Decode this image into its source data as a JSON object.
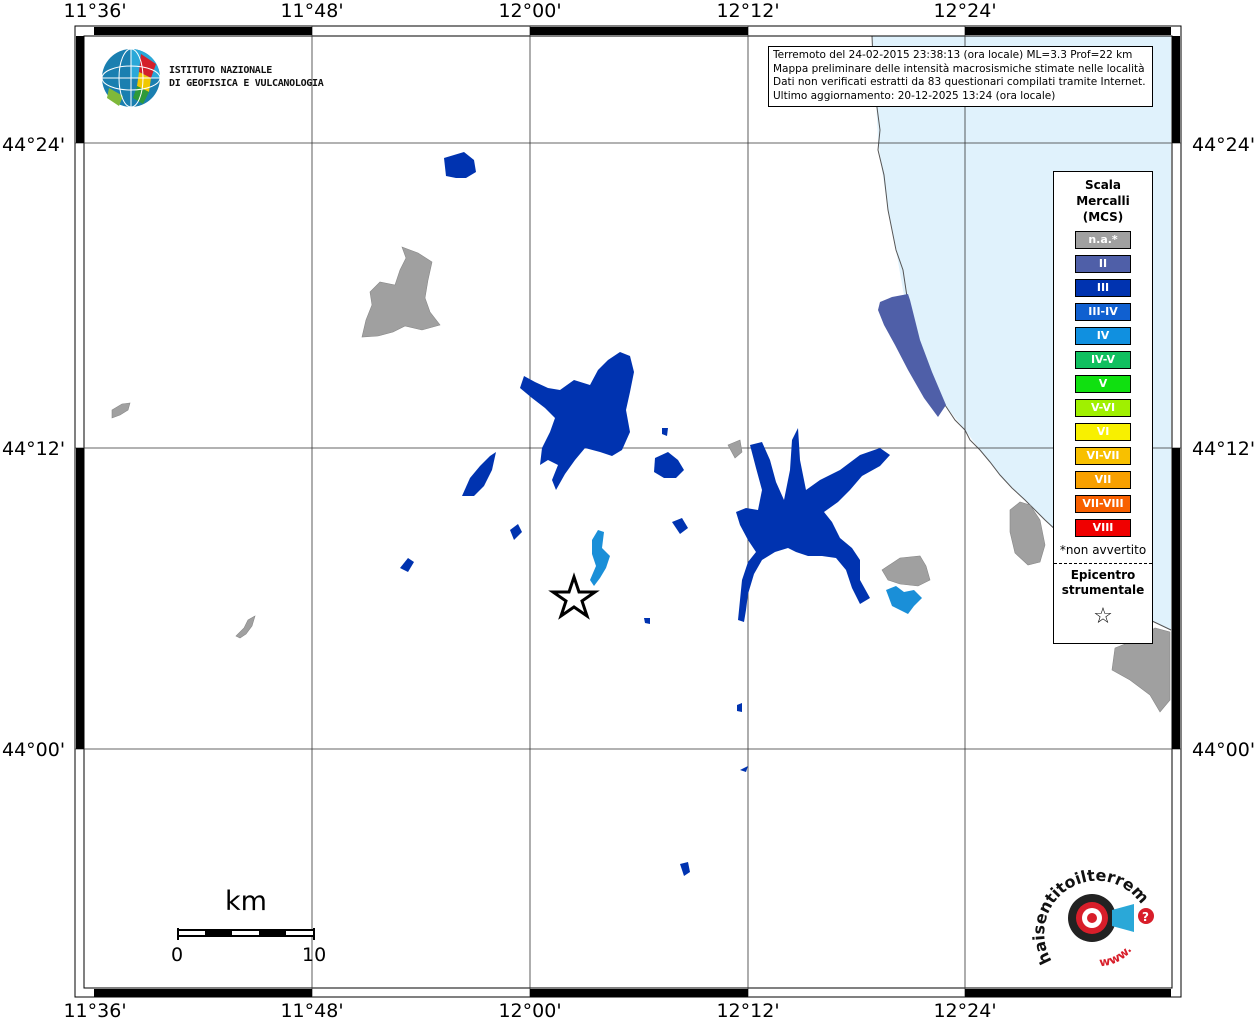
{
  "axes": {
    "longitude_ticks": [
      "11°36'",
      "11°48'",
      "12°00'",
      "12°12'",
      "12°24'"
    ],
    "latitude_ticks_left": [
      "44°24'",
      "44°12'",
      "44°00'"
    ],
    "latitude_ticks_right": [
      "44°24'",
      "44°12'",
      "44°00'"
    ]
  },
  "ingv_logo": {
    "line1": "ISTITUTO NAZIONALE",
    "line2": "DI GEOFISICA E VULCANOLOGIA"
  },
  "info": {
    "line1": "Terremoto del 24-02-2015 23:38:13 (ora locale) ML=3.3 Prof=22 km",
    "line2": "Mappa preliminare delle intensità macrosismiche stimate nelle località",
    "line3": "Dati non verificati estratti da 83 questionari compilati tramite Internet.",
    "line4": "Ultimo aggiornamento: 20-12-2025 13:24 (ora locale)"
  },
  "legend": {
    "title1": "Scala",
    "title2": "Mercalli",
    "title3": "(MCS)",
    "items": [
      {
        "label": "n.a.*",
        "color": "#a0a0a0"
      },
      {
        "label": "II",
        "color": "#4f5fa8"
      },
      {
        "label": "III",
        "color": "#0033b0"
      },
      {
        "label": "III-IV",
        "color": "#1060d0"
      },
      {
        "label": "IV",
        "color": "#1090e0"
      },
      {
        "label": "IV-V",
        "color": "#10c060"
      },
      {
        "label": "V",
        "color": "#10e010"
      },
      {
        "label": "V-VI",
        "color": "#a0f000"
      },
      {
        "label": "VI",
        "color": "#f8f000"
      },
      {
        "label": "VI-VII",
        "color": "#f8c000"
      },
      {
        "label": "VII",
        "color": "#f8a000"
      },
      {
        "label": "VII-VIII",
        "color": "#f86000"
      },
      {
        "label": "VIII",
        "color": "#f00000"
      }
    ],
    "note": "*non avvertito",
    "epicenter1": "Epicentro",
    "epicenter2": "strumentale",
    "epicenter_symbol": "☆"
  },
  "scale_bar": {
    "unit": "km",
    "start": "0",
    "end": "10"
  },
  "hsit_logo": {
    "text": "haisentitoilterremoto.it",
    "url_text": "www."
  },
  "colors": {
    "sea": "#e0f2fc",
    "na": "#a0a0a0",
    "ii": "#4f5fa8",
    "iii": "#0033b0",
    "iii_iv": "#1060d0",
    "iv": "#1a8fd8"
  }
}
